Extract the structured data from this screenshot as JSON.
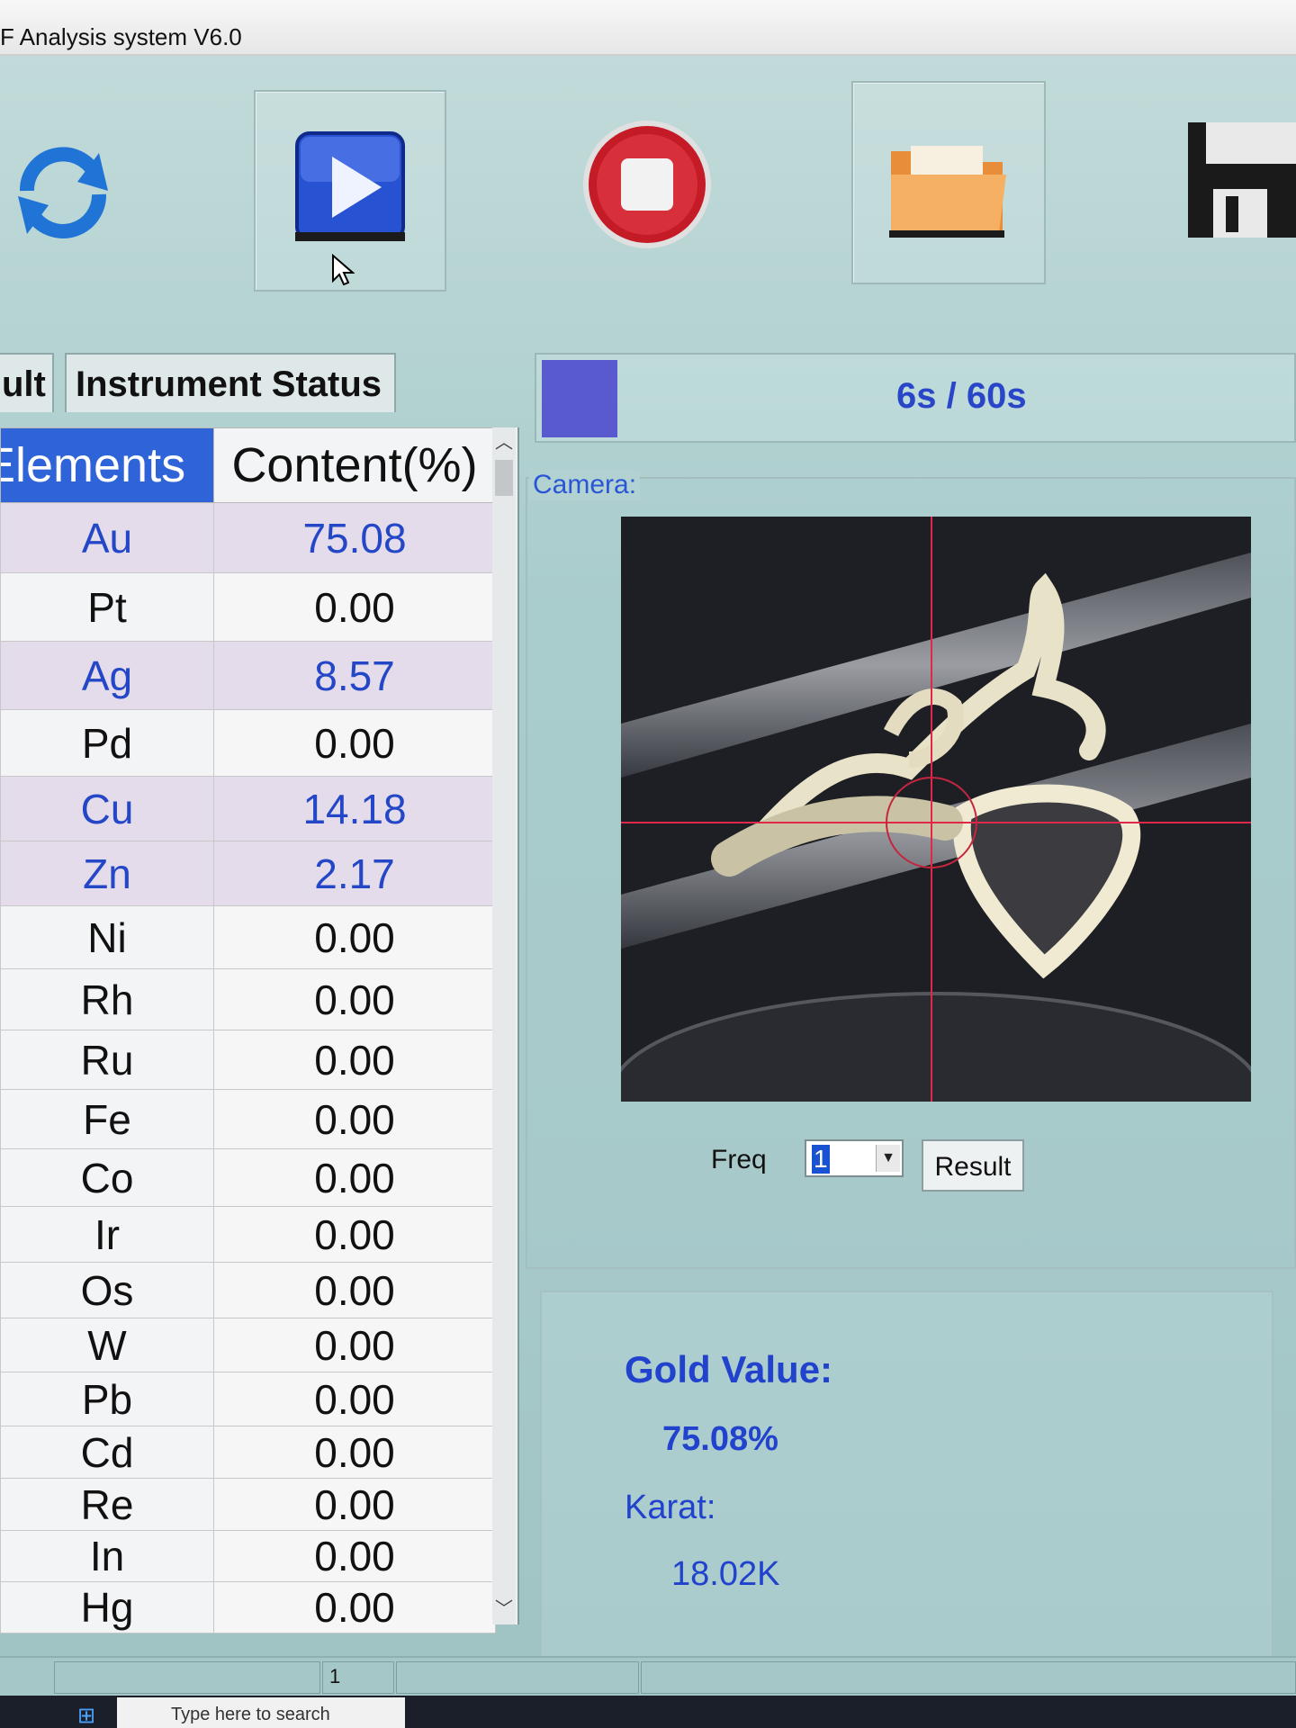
{
  "window": {
    "title": "F Analysis system V6.0"
  },
  "toolbar": {
    "icons": [
      "refresh-icon",
      "play-icon",
      "stop-icon",
      "folder-icon",
      "save-icon"
    ]
  },
  "tabs": [
    {
      "label": "ult"
    },
    {
      "label": "Instrument Status"
    }
  ],
  "progress": {
    "text": "6s / 60s",
    "fraction": 0.1
  },
  "table": {
    "headers": [
      "Elements",
      "Content(%)"
    ],
    "rows": [
      {
        "element": "Au",
        "value": "75.08",
        "highlight": true
      },
      {
        "element": "Pt",
        "value": "0.00",
        "highlight": false
      },
      {
        "element": "Ag",
        "value": "8.57",
        "highlight": true
      },
      {
        "element": "Pd",
        "value": "0.00",
        "highlight": false
      },
      {
        "element": "Cu",
        "value": "14.18",
        "highlight": true
      },
      {
        "element": "Zn",
        "value": "2.17",
        "highlight": true
      },
      {
        "element": "Ni",
        "value": "0.00",
        "highlight": false
      },
      {
        "element": "Rh",
        "value": "0.00",
        "highlight": false
      },
      {
        "element": "Ru",
        "value": "0.00",
        "highlight": false
      },
      {
        "element": "Fe",
        "value": "0.00",
        "highlight": false
      },
      {
        "element": "Co",
        "value": "0.00",
        "highlight": false
      },
      {
        "element": "Ir",
        "value": "0.00",
        "highlight": false
      },
      {
        "element": "Os",
        "value": "0.00",
        "highlight": false
      },
      {
        "element": "W",
        "value": "0.00",
        "highlight": false
      },
      {
        "element": "Pb",
        "value": "0.00",
        "highlight": false
      },
      {
        "element": "Cd",
        "value": "0.00",
        "highlight": false
      },
      {
        "element": "Re",
        "value": "0.00",
        "highlight": false
      },
      {
        "element": "In",
        "value": "0.00",
        "highlight": false
      },
      {
        "element": "Hg",
        "value": "0.00",
        "highlight": false
      }
    ]
  },
  "camera": {
    "label": "Camera:"
  },
  "freq": {
    "label": "Freq",
    "value": "1",
    "result_button": "Result"
  },
  "gold": {
    "value_label": "Gold Value:",
    "value": "75.08%",
    "karat_label": "Karat:",
    "karat": "18.02K"
  },
  "statusbar": {
    "page": "1"
  },
  "taskbar": {
    "search_placeholder": "Type here to search"
  },
  "colors": {
    "accent_blue": "#2f63d8",
    "highlight_text": "#2447c7",
    "highlight_row": "#e4dcea",
    "gold_text": "#2142cc",
    "progress_fill": "#5a5ad0"
  }
}
